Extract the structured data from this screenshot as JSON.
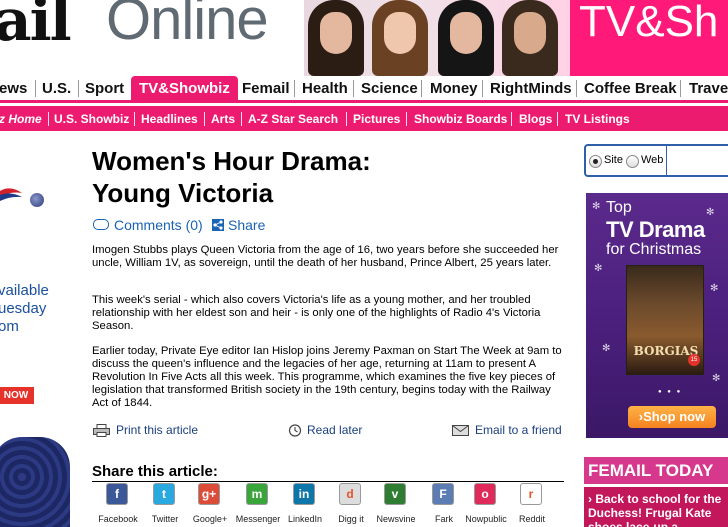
{
  "masthead": {
    "logo_mail": "ail",
    "logo_online": "Online",
    "section_title": "TV&Sh"
  },
  "primary_nav": {
    "items": [
      "ews",
      "U.S.",
      "Sport",
      "TV&Showbiz",
      "Femail",
      "Health",
      "Science",
      "Money",
      "RightMinds",
      "Coffee Break",
      "Trave"
    ],
    "active": "TV&Showbiz"
  },
  "secondary_nav": {
    "items": [
      "z Home",
      "U.S. Showbiz",
      "Headlines",
      "Arts",
      "A-Z Star Search",
      "Pictures",
      "Showbiz Boards",
      "Blogs",
      "TV Listings"
    ]
  },
  "left_ad": {
    "lines": [
      "vailable",
      "uesday",
      "om"
    ],
    "badge": "NOW"
  },
  "article": {
    "title_line1": "Women's Hour Drama:",
    "title_line2": "Young Victoria",
    "comments": "Comments (0)",
    "share_link": "Share",
    "paragraphs": [
      "Imogen Stubbs plays Queen Victoria from the age of 16, two years before she succeeded her uncle, William 1V, as sovereign, until the death of her husband, Prince Albert, 25 years later.",
      "This week's serial - which also covers Victoria's life as a young mother, and her troubled relationship with her eldest son and heir - is only one of the highlights of Radio 4's Victoria Season.",
      "Earlier today, Private Eye editor Ian Hislop joins Jeremy Paxman on Start The Week at 9am to discuss the queen's influence and the legacies of her age, returning at 11am to present A Revolution In Five Acts all this week. This programme, which examines the five key pieces of legislation that transformed British society in the 19th century, begins today with the Railway Act of 1844."
    ],
    "tools": {
      "print": "Print this article",
      "read_later": "Read later",
      "email": "Email to a friend"
    },
    "share_heading": "Share this article:",
    "share_services": [
      {
        "label": "Facebook",
        "icon": "facebook-icon",
        "color": "#3b5998",
        "glyph": "f"
      },
      {
        "label": "Twitter",
        "icon": "twitter-icon",
        "color": "#2aa9e0",
        "glyph": "t"
      },
      {
        "label": "Google+",
        "icon": "google-plus-icon",
        "color": "#dd4b39",
        "glyph": "g+"
      },
      {
        "label": "Messenger",
        "icon": "messenger-icon",
        "color": "#3aa53a",
        "glyph": "m"
      },
      {
        "label": "LinkedIn",
        "icon": "linkedin-icon",
        "color": "#0e76a8",
        "glyph": "in"
      },
      {
        "label": "Digg it",
        "icon": "digg-icon",
        "color": "#dddddd",
        "glyph": "d"
      },
      {
        "label": "Newsvine",
        "icon": "newsvine-icon",
        "color": "#2f7d32",
        "glyph": "v"
      },
      {
        "label": "Fark",
        "icon": "fark-icon",
        "color": "#5c7db3",
        "glyph": "F"
      },
      {
        "label": "Nowpublic",
        "icon": "nowpublic-icon",
        "color": "#e02a5a",
        "glyph": "o"
      },
      {
        "label": "Reddit",
        "icon": "reddit-icon",
        "color": "#ffffff",
        "glyph": "r"
      }
    ]
  },
  "search": {
    "option_site": "Site",
    "option_web": "Web",
    "selected": "Site"
  },
  "promo": {
    "line1": "Top",
    "line2": "TV Drama",
    "line3": "for Christmas",
    "dvd_title": "BORGIAS",
    "dvd_rating": "15",
    "button": "›Shop now"
  },
  "femail_today": {
    "heading": "FEMAIL TODAY",
    "story": "› Back to school for the Duchess! Frugal Kate shoes lace-up a..."
  },
  "colors": {
    "brand_pink": "#ec1b6f",
    "link_blue": "#1a63b5",
    "promo_purple": "#4a1f7c",
    "shop_orange": "#f58220"
  }
}
